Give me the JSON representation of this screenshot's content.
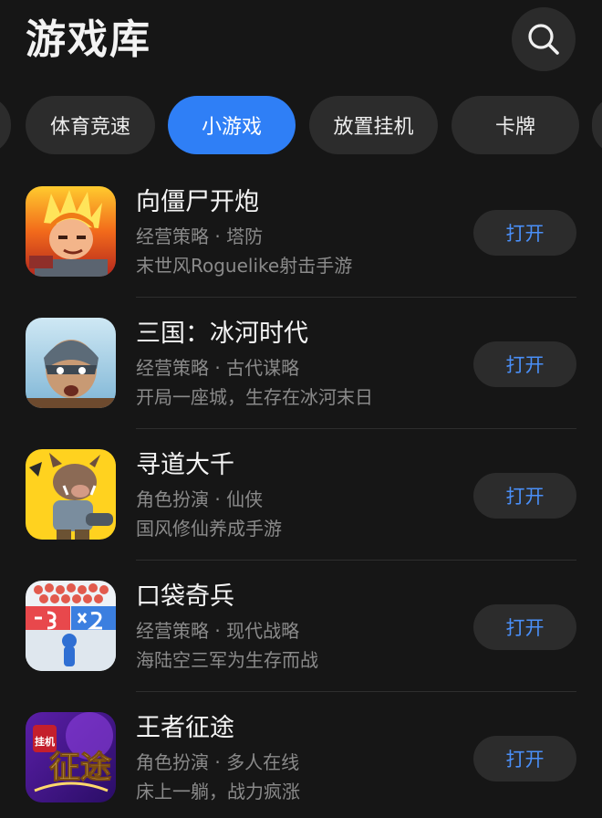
{
  "header": {
    "title": "游戏库",
    "search_icon": "search-icon"
  },
  "tabs": [
    {
      "label": "",
      "active": false
    },
    {
      "label": "体育竞速",
      "active": false
    },
    {
      "label": "小游戏",
      "active": true
    },
    {
      "label": "放置挂机",
      "active": false
    },
    {
      "label": "卡牌",
      "active": false
    },
    {
      "label": "",
      "active": false
    }
  ],
  "games": [
    {
      "name": "向僵尸开炮",
      "category": "经营策略",
      "subcategory": "塔防",
      "description": "末世风Roguelike射击手游",
      "button": "打开"
    },
    {
      "name": "三国：冰河时代",
      "category": "经营策略",
      "subcategory": "古代谋略",
      "description": "开局一座城，生存在冰河末日",
      "button": "打开"
    },
    {
      "name": "寻道大千",
      "category": "角色扮演",
      "subcategory": "仙侠",
      "description": "国风修仙养成手游",
      "button": "打开"
    },
    {
      "name": "口袋奇兵",
      "category": "经营策略",
      "subcategory": "现代战略",
      "description": "海陆空三军为生存而战",
      "button": "打开"
    },
    {
      "name": "王者征途",
      "category": "角色扮演",
      "subcategory": "多人在线",
      "description": "床上一躺，战力疯涨",
      "button": "打开",
      "icon_text": "挂机",
      "icon_logo": "征途"
    }
  ],
  "meta_separator": " · ",
  "colors": {
    "background": "#161616",
    "accent": "#2f7ff6",
    "button_text": "#4a8ff8",
    "secondary_text": "#8a8a8a"
  }
}
